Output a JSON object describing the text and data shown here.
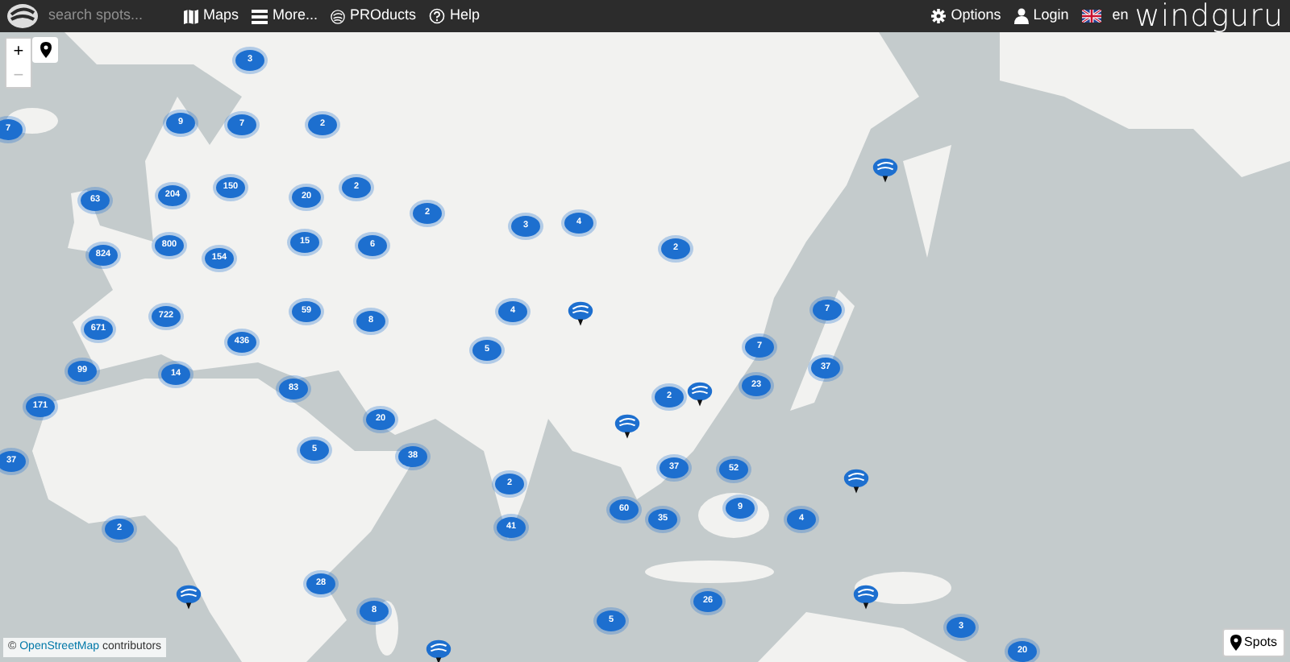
{
  "topbar": {
    "search": {
      "placeholder": "search spots..."
    },
    "menu": [
      {
        "label": "Maps",
        "kind": "map"
      },
      {
        "label": "More...",
        "kind": "menu"
      },
      {
        "label": "PROducts",
        "kind": "logo"
      },
      {
        "label": "Help",
        "kind": "help"
      }
    ],
    "right": [
      {
        "label": "Options",
        "kind": "gear"
      },
      {
        "label": "Login",
        "kind": "user"
      }
    ],
    "language": "en",
    "logo": "windguru"
  },
  "zoom": {
    "in": "+",
    "out": "−",
    "out_disabled": true
  },
  "markers": [
    {
      "kind": "cluster",
      "count": "3"
    },
    {
      "kind": "cluster",
      "count": "7"
    },
    {
      "kind": "cluster",
      "count": "9"
    },
    {
      "kind": "cluster",
      "count": "7"
    },
    {
      "kind": "cluster",
      "count": "2"
    },
    {
      "kind": "cluster",
      "count": "63"
    },
    {
      "kind": "cluster",
      "count": "204"
    },
    {
      "kind": "cluster",
      "count": "150"
    },
    {
      "kind": "cluster",
      "count": "20"
    },
    {
      "kind": "cluster",
      "count": "2"
    },
    {
      "kind": "cluster",
      "count": "2"
    },
    {
      "kind": "cluster",
      "count": "824"
    },
    {
      "kind": "cluster",
      "count": "800"
    },
    {
      "kind": "cluster",
      "count": "154"
    },
    {
      "kind": "cluster",
      "count": "15"
    },
    {
      "kind": "cluster",
      "count": "6"
    },
    {
      "kind": "cluster",
      "count": "3"
    },
    {
      "kind": "cluster",
      "count": "4"
    },
    {
      "kind": "cluster",
      "count": "2"
    },
    {
      "kind": "cluster",
      "count": "59"
    },
    {
      "kind": "cluster",
      "count": "722"
    },
    {
      "kind": "cluster",
      "count": "8"
    },
    {
      "kind": "cluster",
      "count": "4"
    },
    {
      "kind": "cluster",
      "count": "671"
    },
    {
      "kind": "cluster",
      "count": "436"
    },
    {
      "kind": "cluster",
      "count": "5"
    },
    {
      "kind": "cluster",
      "count": "7"
    },
    {
      "kind": "cluster",
      "count": "7"
    },
    {
      "kind": "cluster",
      "count": "37"
    },
    {
      "kind": "cluster",
      "count": "99"
    },
    {
      "kind": "cluster",
      "count": "14"
    },
    {
      "kind": "cluster",
      "count": "83"
    },
    {
      "kind": "cluster",
      "count": "2"
    },
    {
      "kind": "cluster",
      "count": "23"
    },
    {
      "kind": "cluster",
      "count": "171"
    },
    {
      "kind": "cluster",
      "count": "20"
    },
    {
      "kind": "cluster",
      "count": "5"
    },
    {
      "kind": "cluster",
      "count": "38"
    },
    {
      "kind": "cluster",
      "count": "37"
    },
    {
      "kind": "cluster",
      "count": "2"
    },
    {
      "kind": "cluster",
      "count": "37"
    },
    {
      "kind": "cluster",
      "count": "52"
    },
    {
      "kind": "cluster",
      "count": "9"
    },
    {
      "kind": "cluster",
      "count": "4"
    },
    {
      "kind": "cluster",
      "count": "60"
    },
    {
      "kind": "cluster",
      "count": "35"
    },
    {
      "kind": "cluster",
      "count": "2"
    },
    {
      "kind": "cluster",
      "count": "41"
    },
    {
      "kind": "cluster",
      "count": "28"
    },
    {
      "kind": "cluster",
      "count": "8"
    },
    {
      "kind": "cluster",
      "count": "26"
    },
    {
      "kind": "cluster",
      "count": "5"
    },
    {
      "kind": "cluster",
      "count": "3"
    },
    {
      "kind": "cluster",
      "count": "20"
    },
    {
      "kind": "spot"
    },
    {
      "kind": "spot"
    },
    {
      "kind": "spot"
    },
    {
      "kind": "spot"
    },
    {
      "kind": "spot"
    },
    {
      "kind": "spot"
    },
    {
      "kind": "spot"
    },
    {
      "kind": "spot"
    }
  ],
  "attribution": {
    "symbol": "©",
    "link": "OpenStreetMap",
    "text": "contributors"
  },
  "spots_button": "Spots"
}
